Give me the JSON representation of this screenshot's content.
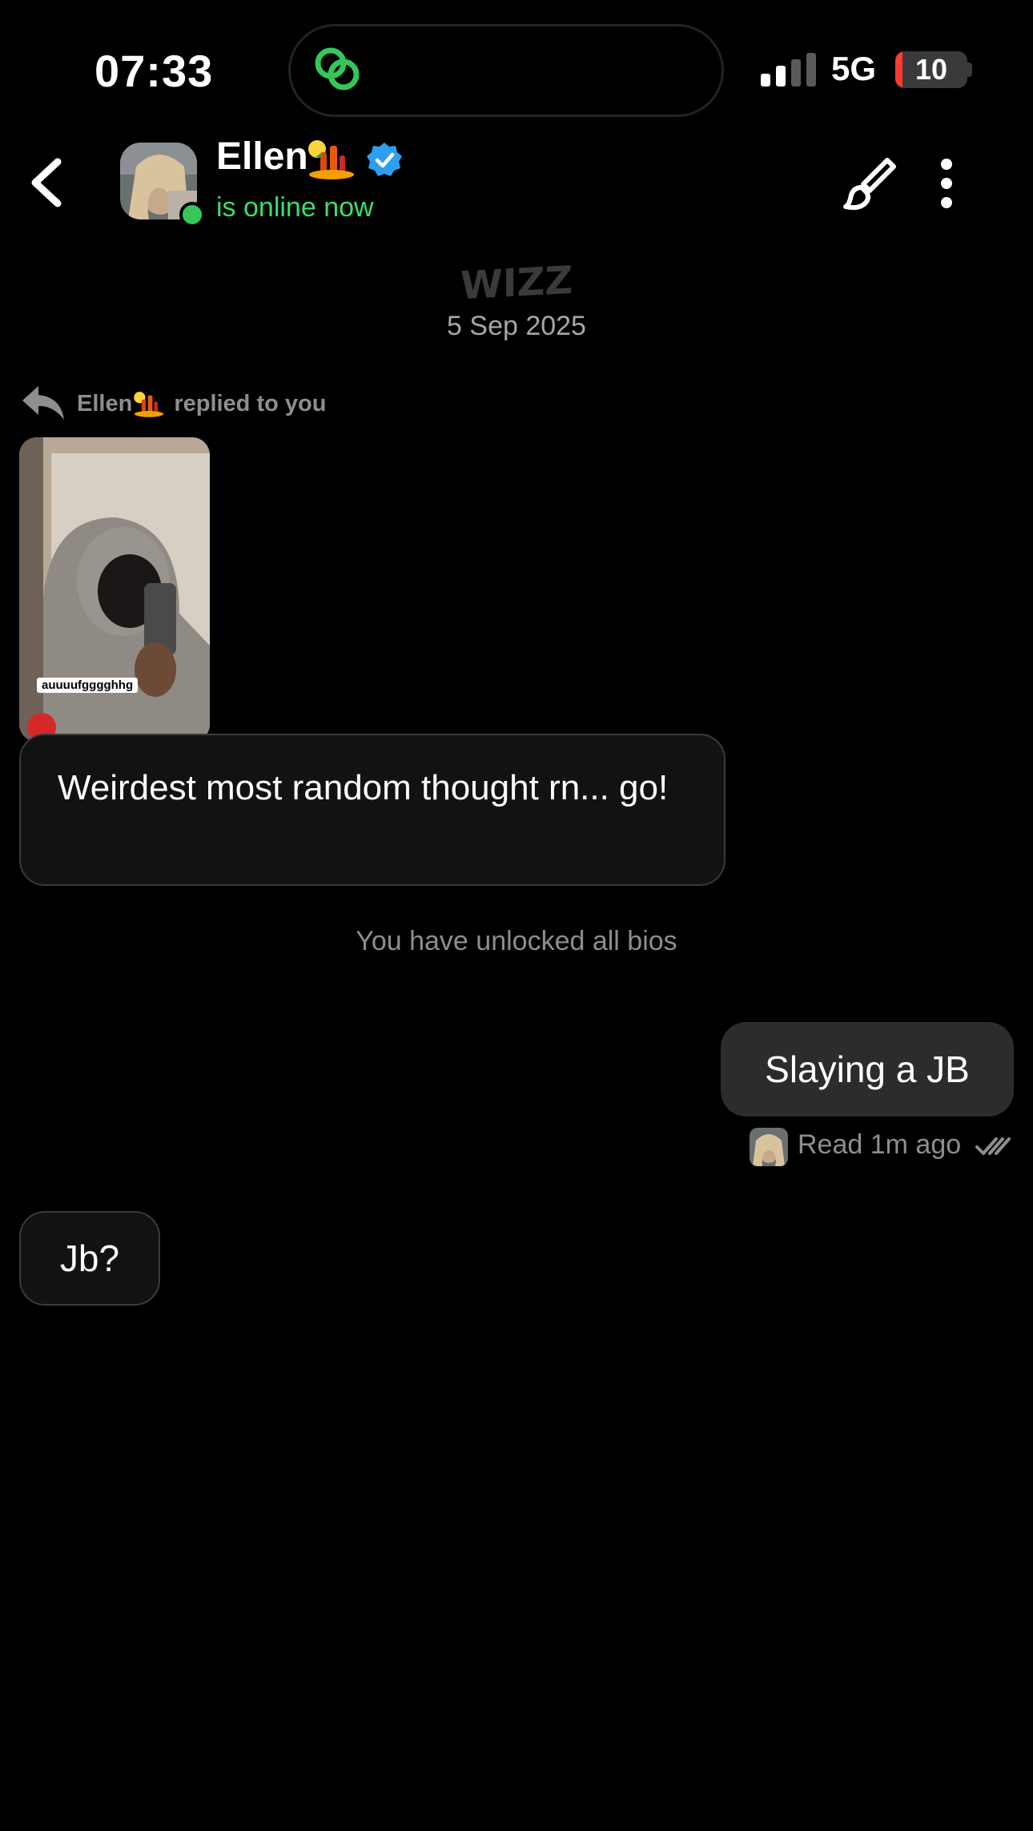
{
  "status_bar": {
    "time": "07:33",
    "network": "5G",
    "battery": "10",
    "battery_level_percent": 10,
    "island_icon": "link-rings-icon",
    "signal_bars_active": 2
  },
  "header": {
    "contact_name": "Ellen",
    "status": "is online now",
    "icons": [
      "back-chevron-icon",
      "verified-badge-icon",
      "paintbrush-icon",
      "more-vertical-icon"
    ],
    "accent_color": "#3ddc6b",
    "verified_color": "#2d9ff0"
  },
  "chat": {
    "app_logo": "WIZZ",
    "date": "5 Sep 2025",
    "reply_label": "Ellen replied to you",
    "reply_name": "Ellen",
    "reply_suffix": "replied to you",
    "photo_caption": "auuuufgggghhg",
    "messages": [
      {
        "side": "received",
        "text": "Weirdest most random thought rn... go!"
      },
      {
        "side": "sent",
        "text": "Slaying a JB"
      },
      {
        "side": "received",
        "text": "Jb?"
      }
    ],
    "system_notice": "You have unlocked all bios",
    "read_receipt": "Read 1m ago"
  }
}
